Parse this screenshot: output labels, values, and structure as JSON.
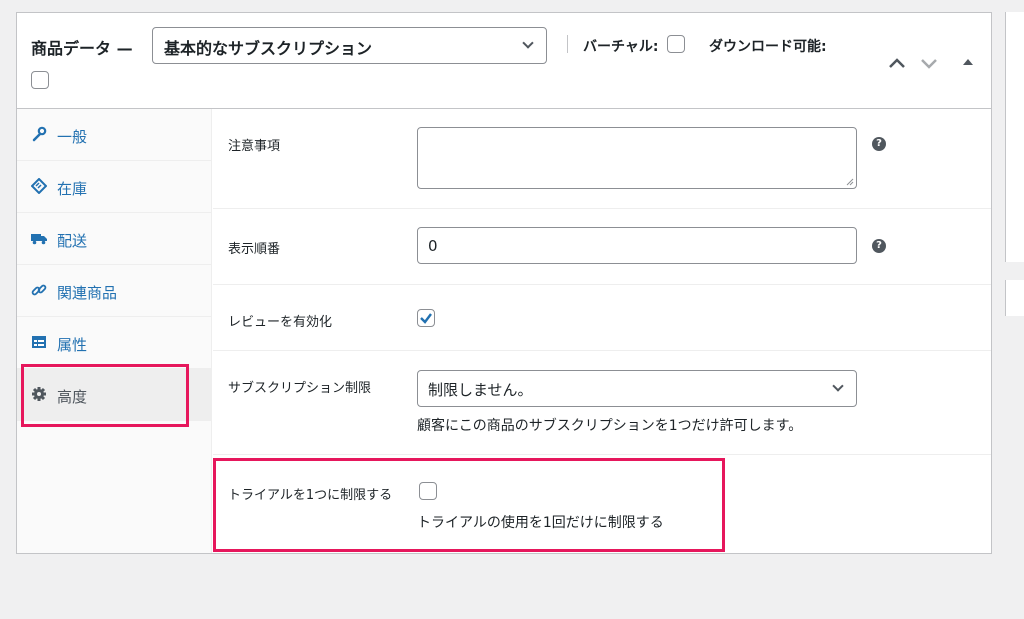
{
  "header": {
    "title": "商品データ —",
    "product_type": "基本的なサブスクリプション",
    "virtual_label": "バーチャル:",
    "downloadable_label": "ダウンロード可能:"
  },
  "sidebar": {
    "items": [
      {
        "label": "一般",
        "icon": "wrench-icon"
      },
      {
        "label": "在庫",
        "icon": "tag-icon"
      },
      {
        "label": "配送",
        "icon": "truck-icon"
      },
      {
        "label": "関連商品",
        "icon": "link-icon"
      },
      {
        "label": "属性",
        "icon": "table-icon"
      },
      {
        "label": "高度",
        "icon": "gear-icon",
        "active": true
      }
    ]
  },
  "fields": {
    "note_label": "注意事項",
    "note_value": "",
    "order_label": "表示順番",
    "order_value": "0",
    "review_label": "レビューを有効化",
    "review_checked": true,
    "sub_limit_label": "サブスクリプション制限",
    "sub_limit_value": "制限しません。",
    "sub_limit_desc": "顧客にこの商品のサブスクリプションを1つだけ許可します。",
    "trial_label": "トライアルを1つに制限する",
    "trial_checked": false,
    "trial_desc": "トライアルの使用を1回だけに制限する"
  },
  "colors": {
    "highlight": "#e6175c",
    "link": "#2271b1",
    "checkbox_check": "#2271b1"
  }
}
